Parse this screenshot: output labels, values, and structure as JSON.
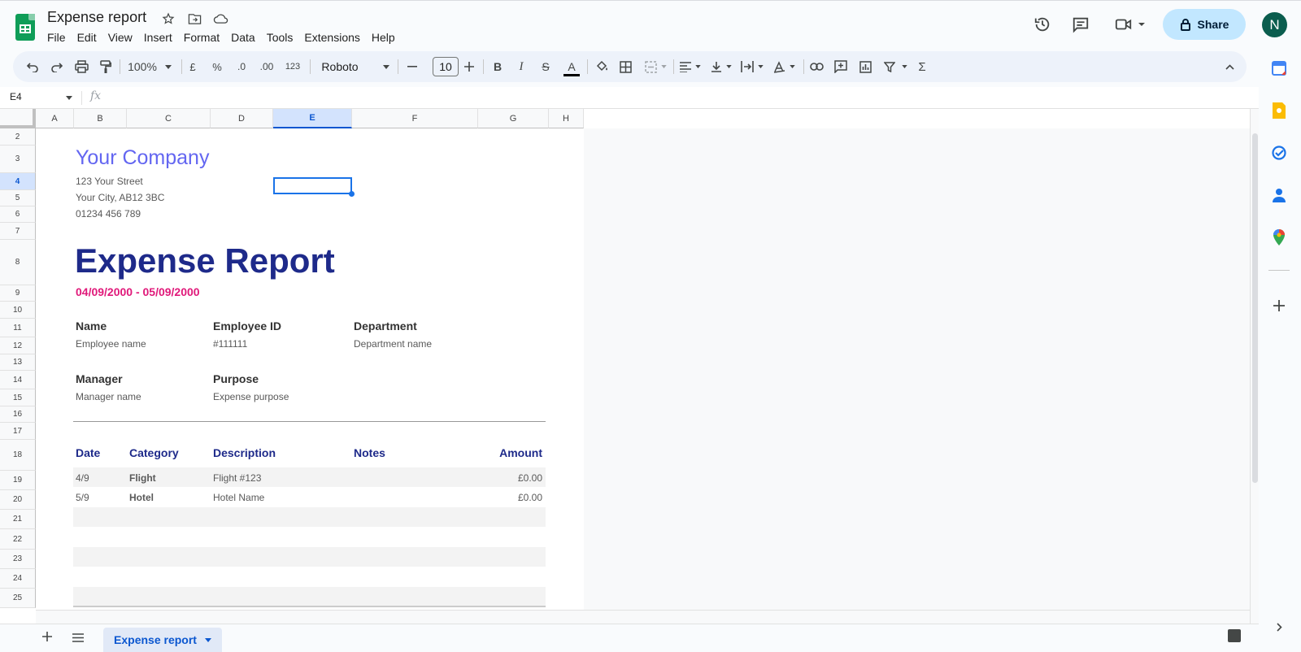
{
  "app": {
    "doc_title": "Expense report",
    "menu": [
      "File",
      "Edit",
      "View",
      "Insert",
      "Format",
      "Data",
      "Tools",
      "Extensions",
      "Help"
    ],
    "share_label": "Share",
    "avatar_initial": "N"
  },
  "toolbar": {
    "zoom": "100%",
    "currency": "£",
    "percent": "%",
    "dec_decrease": ".0",
    "dec_increase": ".00",
    "number_format": "123",
    "font": "Roboto",
    "font_size": "10",
    "bold": "B",
    "italic": "I",
    "strike": "S",
    "text_color": "A",
    "sum": "Σ"
  },
  "formula_bar": {
    "cell_ref": "E4",
    "fx": "fx",
    "value": ""
  },
  "grid": {
    "columns": [
      "A",
      "B",
      "C",
      "D",
      "E",
      "F",
      "G",
      "H"
    ],
    "rows": [
      "2",
      "3",
      "4",
      "5",
      "6",
      "7",
      "8",
      "9",
      "10",
      "11",
      "12",
      "13",
      "14",
      "15",
      "16",
      "17",
      "18",
      "19",
      "20",
      "21",
      "22",
      "23",
      "24",
      "25"
    ],
    "selected_column": "E",
    "selected_row": "4"
  },
  "sheet": {
    "company": "Your Company",
    "address": [
      "123 Your Street",
      "Your City, AB12 3BC",
      "01234 456 789"
    ],
    "title": "Expense Report",
    "date_range": "04/09/2000 - 05/09/2000",
    "fields": {
      "name_label": "Name",
      "name_value": "Employee name",
      "id_label": "Employee ID",
      "id_value": "#111111",
      "dept_label": "Department",
      "dept_value": "Department name",
      "manager_label": "Manager",
      "manager_value": "Manager name",
      "purpose_label": "Purpose",
      "purpose_value": "Expense purpose"
    },
    "table": {
      "headers": [
        "Date",
        "Category",
        "Description",
        "Notes",
        "Amount"
      ],
      "rows": [
        [
          "4/9",
          "Flight",
          "Flight #123",
          "",
          "£0.00"
        ],
        [
          "5/9",
          "Hotel",
          "Hotel Name",
          "",
          "£0.00"
        ]
      ]
    }
  },
  "tabs": {
    "active": "Expense report"
  },
  "colors": {
    "company": "#6366f1",
    "title": "#1e2a8a",
    "date": "#e0197a",
    "selection": "#1a73e8",
    "share_bg": "#c2e7ff"
  }
}
